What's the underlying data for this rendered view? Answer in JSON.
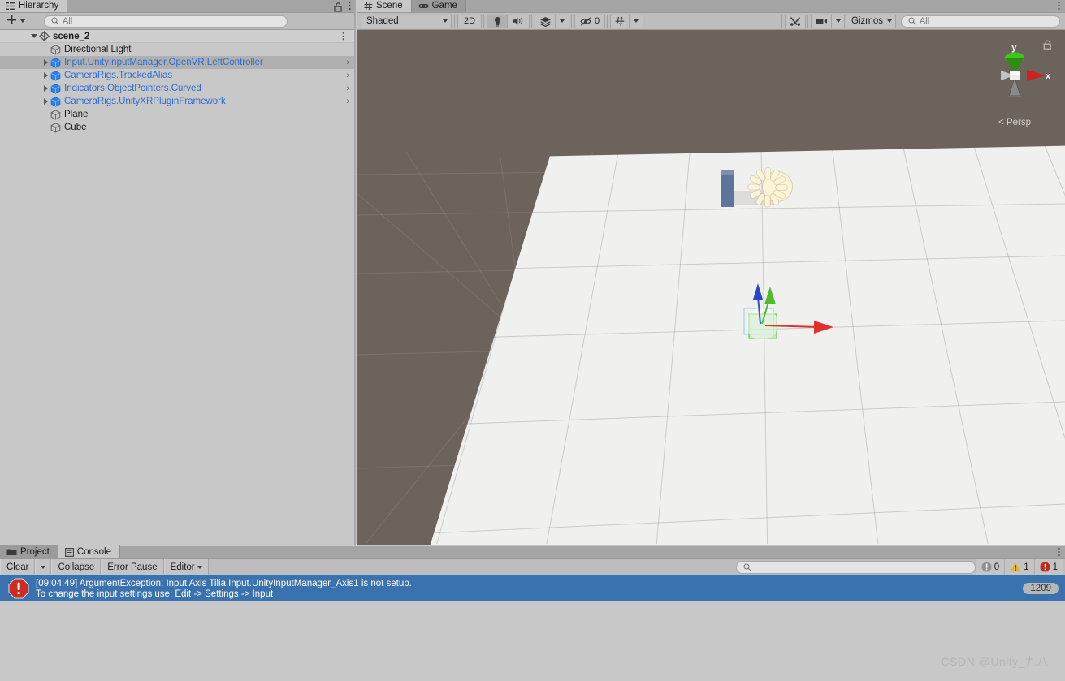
{
  "hierarchy": {
    "tab": {
      "label": "Hierarchy",
      "icon": "hierarchy-icon"
    },
    "lock_icon": "padlock-open-icon",
    "menu_icon": "kebab-menu-icon",
    "add_button": {
      "label": "+",
      "icon": "plus-icon"
    },
    "search": {
      "placeholder": "All",
      "value": "",
      "icon": "search-icon"
    },
    "rows": [
      {
        "name": "scene_2",
        "type": "scene",
        "icon": "unity-scene-icon",
        "depth": 0,
        "expanded": true,
        "prefab": false,
        "selected": false,
        "kebab": "⋮"
      },
      {
        "name": "Directional Light",
        "type": "gameobject",
        "icon": "gameobject-cube-icon",
        "depth": 1,
        "expanded": null,
        "prefab": false,
        "selected": false
      },
      {
        "name": "Input.UnityInputManager.OpenVR.LeftController",
        "type": "prefab",
        "icon": "prefab-cube-icon",
        "depth": 1,
        "expanded": false,
        "prefab": true,
        "selected": true,
        "chevron": "›"
      },
      {
        "name": "CameraRigs.TrackedAlias",
        "type": "prefab",
        "icon": "prefab-cube-icon",
        "depth": 1,
        "expanded": false,
        "prefab": true,
        "selected": false,
        "chevron": "›"
      },
      {
        "name": "Indicators.ObjectPointers.Curved",
        "type": "prefab",
        "icon": "prefab-cube-icon",
        "depth": 1,
        "expanded": false,
        "prefab": true,
        "selected": false,
        "chevron": "›"
      },
      {
        "name": "CameraRigs.UnityXRPluginFramework",
        "type": "prefab",
        "icon": "prefab-cube-icon",
        "depth": 1,
        "expanded": false,
        "prefab": true,
        "selected": false,
        "chevron": "›"
      },
      {
        "name": "Plane",
        "type": "gameobject",
        "icon": "gameobject-cube-icon",
        "depth": 1,
        "expanded": null,
        "prefab": false,
        "selected": false
      },
      {
        "name": "Cube",
        "type": "gameobject",
        "icon": "gameobject-cube-icon",
        "depth": 1,
        "expanded": null,
        "prefab": false,
        "selected": false
      }
    ]
  },
  "sceneview": {
    "tabs": [
      {
        "label": "Scene",
        "icon": "grid-hash-icon",
        "active": true
      },
      {
        "label": "Game",
        "icon": "gamepad-icon",
        "active": false
      }
    ],
    "menu_icon": "kebab-menu-icon",
    "toolbar": {
      "draw_mode": "Shaded",
      "toggle_2d": "2D",
      "lighting_icon": "lightbulb-icon",
      "audio_icon": "speaker-icon",
      "fx_icon": "effects-layers-icon",
      "hidden_objects_icon": "eye-slash-icon",
      "hidden_objects_count": "0",
      "grid_icon": "grid-snap-icon",
      "tools_icon": "scene-tools-icon",
      "camera_icon": "camera-icon",
      "gizmos_label": "Gizmos",
      "search": {
        "placeholder": "All",
        "value": "",
        "icon": "search-icon"
      }
    },
    "gizmo": {
      "axis_y_label": "y",
      "axis_x_label": "x",
      "projection": "< Persp",
      "lock_icon": "padlock-open-icon",
      "colors": {
        "x": "#d12020",
        "y": "#3fc61e",
        "z": "#2060d1",
        "neutral": "#c5c5c5"
      }
    },
    "objects": {
      "directional_light_gizmo": "sun-icon",
      "cube_object": "cube-mesh",
      "move_handle": {
        "x_axis_color": "#e03020",
        "y_axis_color": "#4fc426",
        "z_axis_color": "#2040d8"
      }
    },
    "colors": {
      "background": "#6b635c",
      "plane": "#f0f0ee"
    }
  },
  "bottom": {
    "tabs": [
      {
        "label": "Project",
        "icon": "folder-icon",
        "active": false
      },
      {
        "label": "Console",
        "icon": "console-list-icon",
        "active": true
      }
    ],
    "menu_icon": "kebab-menu-icon",
    "toolbar": {
      "clear_label": "Clear",
      "collapse_label": "Collapse",
      "error_pause_label": "Error Pause",
      "editor_label": "Editor",
      "search": {
        "placeholder": "",
        "value": "",
        "icon": "search-icon"
      },
      "counters": [
        {
          "kind": "info",
          "icon": "info-icon",
          "count": "0",
          "color": "#8f8f8f"
        },
        {
          "kind": "warning",
          "icon": "warning-triangle-icon",
          "count": "1",
          "color": "#e6b422"
        },
        {
          "kind": "error",
          "icon": "error-octagon-icon",
          "count": "1",
          "color": "#c2281e"
        }
      ]
    },
    "messages": [
      {
        "severity": "error",
        "icon": "error-octagon-icon",
        "line1": "[09:04:49] ArgumentException: Input Axis Tilia.Input.UnityInputManager_Axis1 is not setup.",
        "line2": "To change the input settings use: Edit -> Settings -> Input",
        "count_badge": "1209",
        "selected": true
      }
    ]
  },
  "watermark": "CSDN @Unity_九八"
}
